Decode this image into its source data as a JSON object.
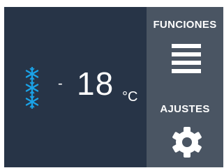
{
  "display": {
    "temperature_sign": "-",
    "temperature_value": "18",
    "temperature_unit": "°C",
    "mode_icon": "snowflake-icon",
    "snowflake_count": 3,
    "snowflake_color": "#1aa3e8"
  },
  "side_menu": {
    "functions_label": "FUNCIONES",
    "functions_icon": "hamburger-menu-icon",
    "settings_label": "AJUSTES",
    "settings_icon": "gear-icon"
  },
  "colors": {
    "main_background": "#273447",
    "side_background": "#4a5563",
    "text": "#ffffff"
  }
}
